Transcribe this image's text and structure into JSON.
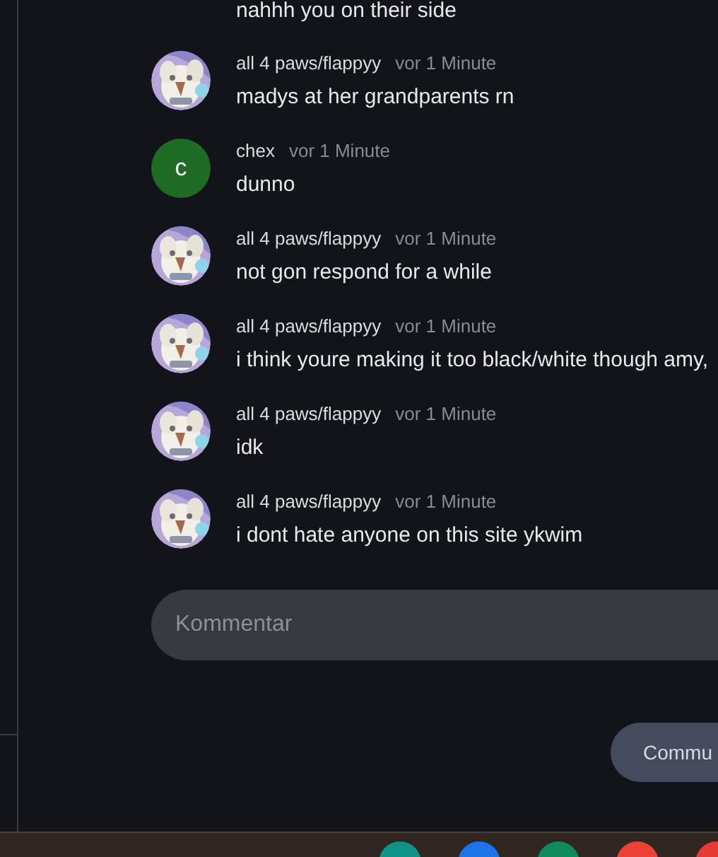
{
  "previous_comment_tail": {
    "text": "nahhh you on their side"
  },
  "comments": [
    {
      "author": "all 4 paws/flappyy",
      "time": "vor 1 Minute",
      "text": "madys at her grandparents rn"
    },
    {
      "author": "chex",
      "time": "vor 1 Minute",
      "text": "dunno",
      "avatar": {
        "kind": "letter",
        "letter": "c",
        "color": "#1e6b23"
      }
    },
    {
      "author": "all 4 paws/flappyy",
      "time": "vor 1 Minute",
      "text": "not gon respond for a while"
    },
    {
      "author": "all 4 paws/flappyy",
      "time": "vor 1 Minute",
      "text": "i think youre making it too black/white though amy,"
    },
    {
      "author": "all 4 paws/flappyy",
      "time": "vor 1 Minute",
      "text": "idk"
    },
    {
      "author": "all 4 paws/flappyy",
      "time": "vor 1 Minute",
      "text": "i dont hate anyone on this site ykwim"
    }
  ],
  "comment_field": {
    "placeholder": "Kommentar"
  },
  "submit_button": {
    "label": "Commu"
  },
  "taskbar": {
    "apps": [
      {
        "color": "#0f9488"
      },
      {
        "color": "#1a73e8"
      },
      {
        "color": "#0f8a5f"
      },
      {
        "color": "#ea4335"
      },
      {
        "color": "#e53935"
      }
    ]
  }
}
